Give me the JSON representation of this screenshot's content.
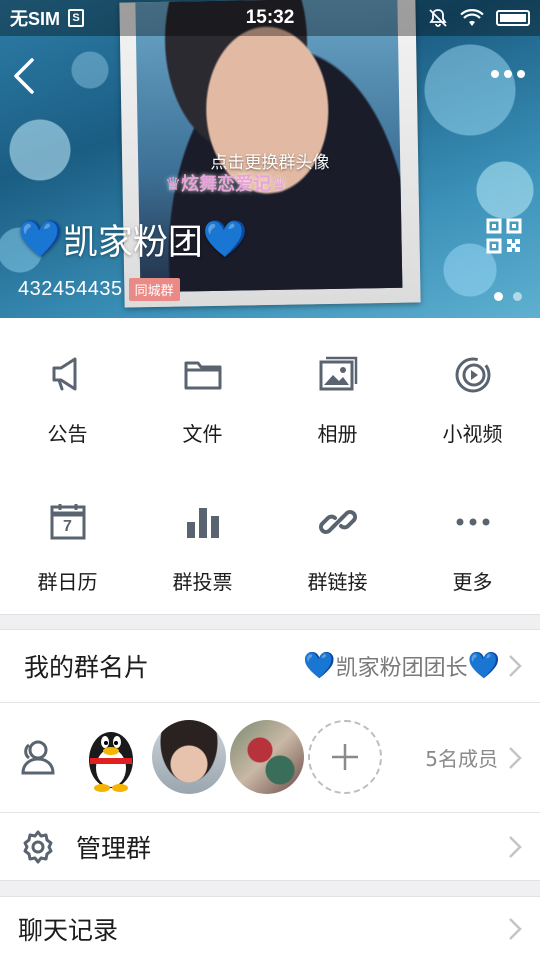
{
  "status_bar": {
    "carrier": "无SIM",
    "sim_icon": "S",
    "time": "15:32"
  },
  "header": {
    "change_avatar_hint": "点击更换群头像",
    "photo_signature": "♛炫舞恋爱记♛",
    "group_name": "凯家粉团",
    "heart_glyph": "💙",
    "group_id": "432454435",
    "group_badge": "同城群"
  },
  "grid": [
    {
      "label": "公告",
      "icon": "megaphone-icon"
    },
    {
      "label": "文件",
      "icon": "folder-icon"
    },
    {
      "label": "相册",
      "icon": "album-icon"
    },
    {
      "label": "小视频",
      "icon": "video-icon"
    },
    {
      "label": "群日历",
      "icon": "calendar-icon",
      "calendar_day": "7"
    },
    {
      "label": "群投票",
      "icon": "poll-icon"
    },
    {
      "label": "群链接",
      "icon": "link-icon"
    },
    {
      "label": "更多",
      "icon": "more-dots-icon"
    }
  ],
  "my_card": {
    "title": "我的群名片",
    "value": "凯家粉团团长"
  },
  "members": {
    "count_text": "5名成员"
  },
  "manage": {
    "title": "管理群"
  },
  "chat_history": {
    "title": "聊天记录"
  },
  "colors": {
    "heart": "#3aa8ee",
    "badge": "#e98a87",
    "icon": "#5a6470"
  }
}
